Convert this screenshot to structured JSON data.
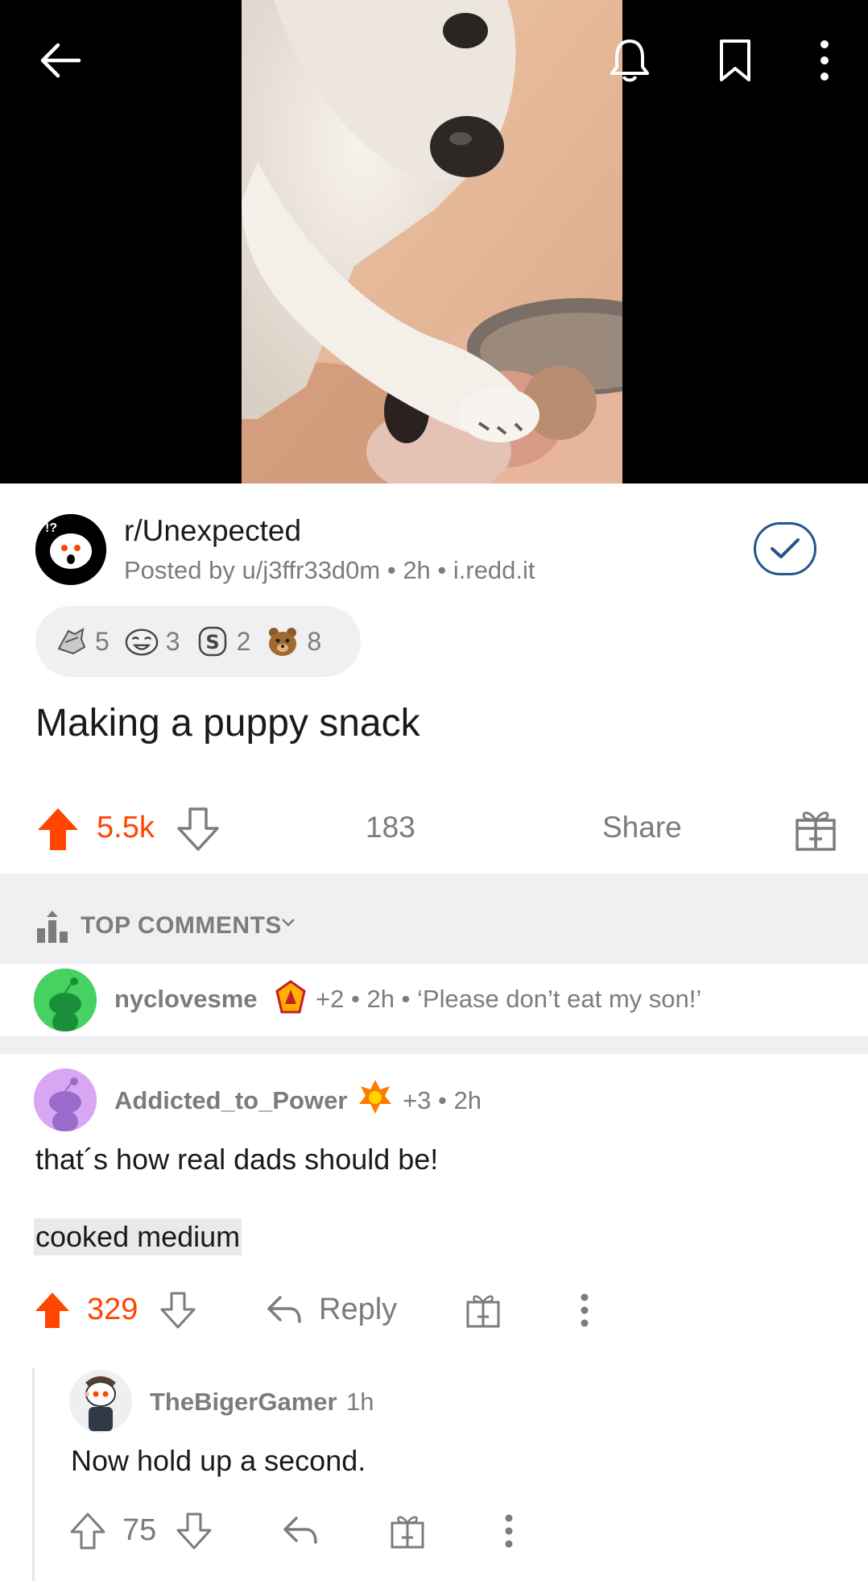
{
  "post": {
    "subreddit": "r/Unexpected",
    "meta": "Posted by u/j3ffr33d0m • 2h • i.redd.it",
    "title": "Making a puppy snack",
    "score": "5.5k",
    "comments_count": "183",
    "share_label": "Share",
    "awards": [
      {
        "icon": "wholesome-seal-award-icon",
        "count": "5"
      },
      {
        "icon": "laughing-face-award-icon",
        "count": "3"
      },
      {
        "icon": "money-bag-award-icon",
        "count": "2"
      },
      {
        "icon": "bear-award-icon",
        "count": "8"
      }
    ]
  },
  "sort": {
    "label": "TOP COMMENTS"
  },
  "pinned_comment": {
    "user": "nyclovesme",
    "flair_count": "+2",
    "meta": "• 2h • ‘Please don’t eat my son!’"
  },
  "comment1": {
    "user": "Addicted_to_Power",
    "flair_count": "+3",
    "time": "• 2h",
    "body": "that´s how real dads should be!",
    "spoiler": "cooked medium",
    "score": "329",
    "reply_label": "Reply"
  },
  "comment2": {
    "user": "TheBigerGamer",
    "time": "1h",
    "body": "Now hold up a second.",
    "score": "75"
  },
  "colors": {
    "upvote": "#ff4500",
    "meta_gray": "#7c7c7c",
    "strip_bg": "#f0f0f2",
    "joined_blue": "#24558f"
  }
}
